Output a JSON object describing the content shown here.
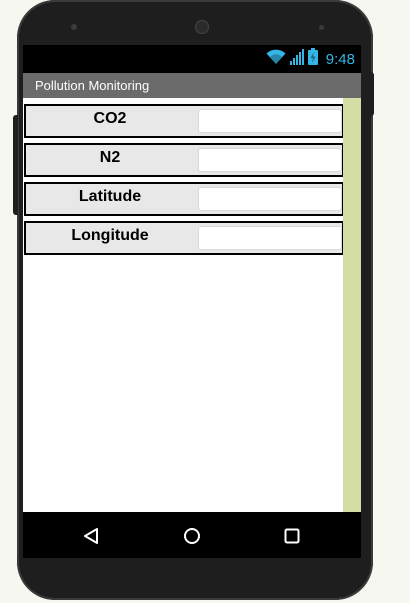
{
  "status_bar": {
    "time": "9:48",
    "icons": [
      "wifi-icon",
      "signal-icon",
      "battery-icon"
    ],
    "icon_color": "#33b5e5"
  },
  "app": {
    "title": "Pollution Monitoring"
  },
  "fields": [
    {
      "label": "CO2",
      "value": ""
    },
    {
      "label": "N2",
      "value": ""
    },
    {
      "label": "Latitude",
      "value": ""
    },
    {
      "label": "Longitude",
      "value": ""
    }
  ],
  "nav_bar": {
    "buttons": [
      "back-icon",
      "home-icon",
      "recents-icon"
    ]
  },
  "colors": {
    "title_bar": "#6b6b6b",
    "row_background": "#e8e8e8",
    "scrollbar": "#d2dea4",
    "phone_body": "#1e1e1e"
  }
}
